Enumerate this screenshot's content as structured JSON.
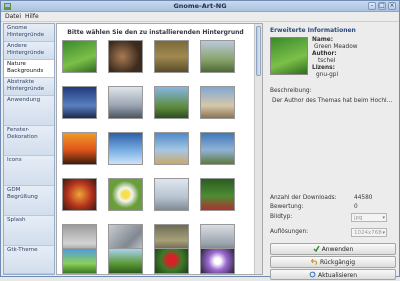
{
  "window": {
    "title": "Gnome-Art-NG"
  },
  "menu": {
    "file": "Datei",
    "help": "Hilfe"
  },
  "sidebar": {
    "items": [
      {
        "label": "Gnome Hintergründe"
      },
      {
        "label": "Andere Hintergründe"
      },
      {
        "label": "Nature Backgrounds"
      },
      {
        "label": "Abstrakte Hintergründe"
      },
      {
        "label": "Anwendung"
      },
      {
        "label": "Fenster-Dekoration"
      },
      {
        "label": "Icons"
      },
      {
        "label": "GDM Begrüßung"
      },
      {
        "label": "Splash"
      },
      {
        "label": "Gtk-Theme"
      }
    ]
  },
  "gallery": {
    "header": "Bitte wählen Sie den zu installierenden Hintergrund"
  },
  "details": {
    "section_title": "Erweiterte Informationen",
    "name_label": "Name:",
    "name_value": "Green Meadow",
    "author_label": "Author:",
    "author_value": "tschel",
    "license_label": "Lizens:",
    "license_value": "gnu-gpl",
    "description_label": "Beschreibung:",
    "description_value": "Der Author des Themas hat beim Hochl...",
    "downloads_label": "Anzahl der Downloads:",
    "downloads_value": "44580",
    "rating_label": "Bewertung:",
    "rating_value": "0",
    "type_label": "Bildtyp:",
    "type_value": "jpg",
    "resolution_label": "Auflösungen:",
    "resolution_value": "1024x768",
    "apply_label": "Anwenden",
    "undo_label": "Rückgängig",
    "update_label": "Aktualisieren"
  },
  "colors": {
    "accent": "#6d8bb3",
    "selected_tab": "#ffffff"
  }
}
